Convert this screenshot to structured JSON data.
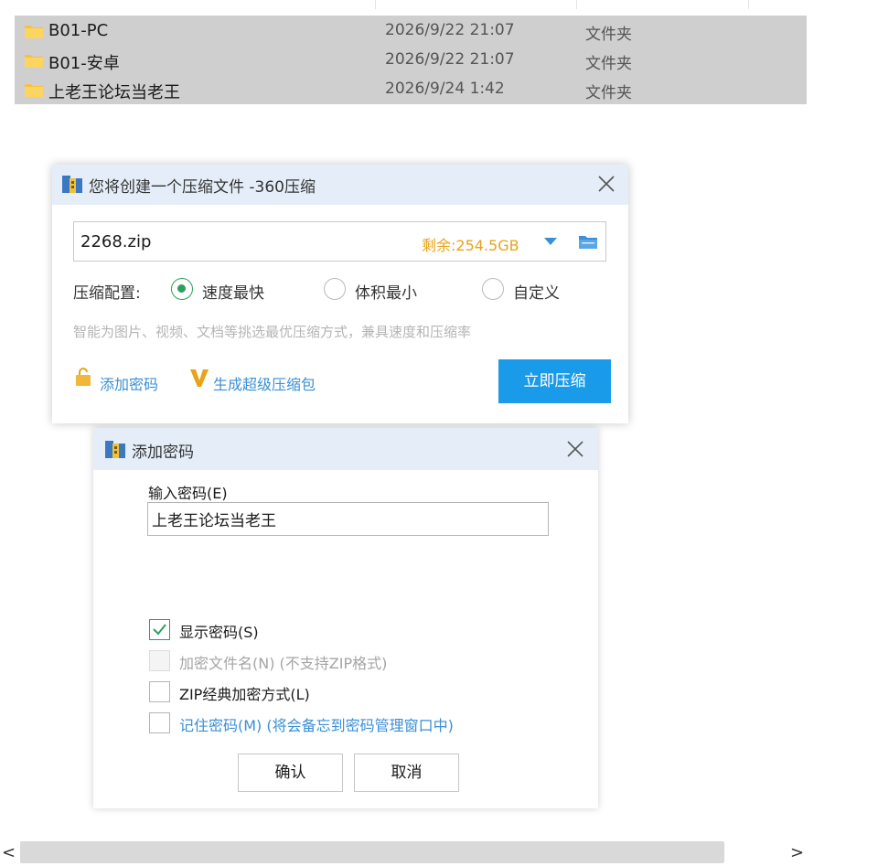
{
  "explorer": {
    "files": [
      {
        "name": "B01-PC",
        "date": "2026/9/22 21:07",
        "type": "文件夹"
      },
      {
        "name": "B01-安卓",
        "date": "2026/9/22 21:07",
        "type": "文件夹"
      },
      {
        "name": "上老王论坛当老王",
        "date": "2026/9/24 1:42",
        "type": "文件夹"
      }
    ]
  },
  "compress_dialog": {
    "title": "您将创建一个压缩文件 -360压缩",
    "filename": "2268.zip",
    "free_space": "剩余:254.5GB",
    "config_label": "压缩配置:",
    "options": [
      "速度最快",
      "体积最小",
      "自定义"
    ],
    "selected_option": "速度最快",
    "hint": "智能为图片、视频、文档等挑选最优压缩方式，兼具速度和压缩率",
    "add_password": "添加密码",
    "super_pack": "生成超级压缩包",
    "compress_button": "立即压缩"
  },
  "password_dialog": {
    "title": "添加密码",
    "input_label": "输入密码(E)",
    "password_value": "上老王论坛当老王",
    "checkboxes": [
      {
        "label": "显示密码(S)",
        "checked": true,
        "enabled": true
      },
      {
        "label": "加密文件名(N) (不支持ZIP格式)",
        "checked": false,
        "enabled": false
      },
      {
        "label": "ZIP经典加密方式(L)",
        "checked": false,
        "enabled": true
      },
      {
        "label": "记住密码(M) (将会备忘到密码管理窗口中)",
        "checked": false,
        "enabled": true
      }
    ],
    "ok_button": "确认",
    "cancel_button": "取消"
  },
  "scrollbar": {
    "left_arrow": "<",
    "right_arrow": ">"
  },
  "colors": {
    "accent": "#1a9bea",
    "warning": "#e8a317",
    "link": "#3a8fd6",
    "check": "#2aa05f",
    "titlebar": "#e5eef8"
  },
  "icons": [
    "folder-icon",
    "app-icon",
    "close-icon",
    "dropdown-arrow-icon",
    "lock-icon",
    "v-icon",
    "checkmark-icon"
  ]
}
